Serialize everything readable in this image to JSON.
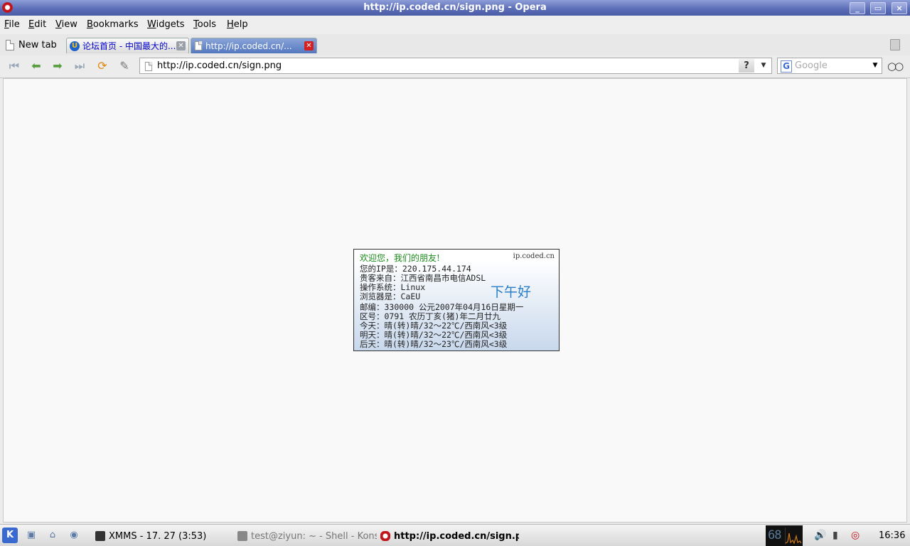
{
  "window": {
    "title": "http://ip.coded.cn/sign.png - Opera",
    "controls": [
      "_",
      "▭",
      "×"
    ]
  },
  "menu": [
    "File",
    "Edit",
    "View",
    "Bookmarks",
    "Widgets",
    "Tools",
    "Help"
  ],
  "tabs": {
    "new_tab_label": "New tab",
    "items": [
      {
        "label": "论坛首页 - 中国最大的...",
        "active": false
      },
      {
        "label": "http://ip.coded.cn/...",
        "active": true
      }
    ]
  },
  "toolbar": {
    "address": "http://ip.coded.cn/sign.png",
    "help_label": "?",
    "search_placeholder": "Google",
    "search_engine_icon": "G"
  },
  "sign": {
    "welcome": "欢迎您，我们的朋友!",
    "site": "ip.coded.cn",
    "lines": [
      "您的IP是：220.175.44.174",
      "贵客来自：江西省南昌市电信ADSL",
      "操作系统：Linux",
      "浏览器是：CaEU",
      "邮编：330000  公元2007年04月16日星期一",
      "区号：0791    农历丁亥(猪)年二月廿九",
      "今天：晴(转)晴/32～22℃/西南风<3级",
      "明天：晴(转)晴/32～22℃/西南风<3级",
      "后天：晴(转)晴/32～23℃/西南风<3级"
    ],
    "greeting": "下午好"
  },
  "taskbar": {
    "tasks": [
      {
        "label": "XMMS - 17. 27 (3:53)"
      },
      {
        "label": "test@ziyun: ~ - Shell - Konsole"
      },
      {
        "label": "http://ip.coded.cn/sign.png - Opera"
      }
    ],
    "monitor_value": "68",
    "clock": "16:36"
  },
  "colors": {
    "titlebar": "#5d6fb8",
    "active_tab": "#5378c0",
    "welcome_text": "#1a8a1a",
    "greeting_text": "#2a7ec8"
  }
}
